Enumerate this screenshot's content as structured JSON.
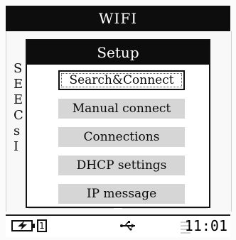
{
  "window": {
    "title": "WIFI"
  },
  "under_screen": {
    "items": [
      "S",
      "E",
      "E",
      "C",
      "s",
      "I"
    ]
  },
  "dialog": {
    "title": "Setup",
    "selected_index": 0,
    "items": [
      {
        "label": "Search&Connect"
      },
      {
        "label": "Manual connect"
      },
      {
        "label": "Connections"
      },
      {
        "label": "DHCP settings"
      },
      {
        "label": "IP message"
      }
    ]
  },
  "status_bar": {
    "battery_icon": "battery-charging-icon",
    "slot_label": "1",
    "usb_icon": "usb-icon",
    "signal_icon": "signal-icon",
    "time": "11:01"
  }
}
